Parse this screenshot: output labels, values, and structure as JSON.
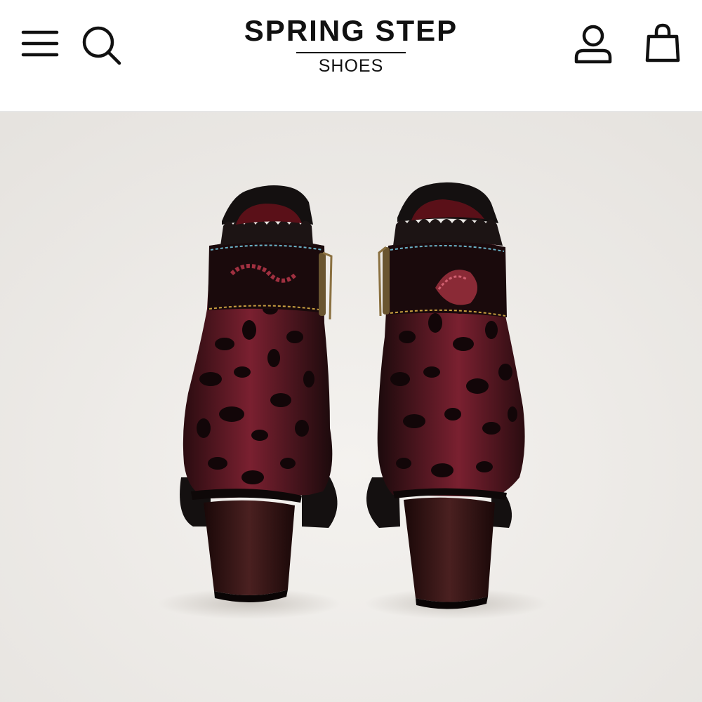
{
  "header": {
    "logo": {
      "main": "SPRING STEP",
      "sub": "SHOES"
    },
    "icons": {
      "menu": "hamburger-menu-icon",
      "search": "search-icon",
      "account": "user-icon",
      "bag": "shopping-bag-icon"
    }
  },
  "product_image": {
    "subject": "pair of burgundy and black leopard print ankle boots with ruffled collar, rear view",
    "colors": {
      "background": "#efedea",
      "boot_base": "#5a1620",
      "boot_dark": "#1a0a0c",
      "heel": "#2a1212"
    }
  }
}
